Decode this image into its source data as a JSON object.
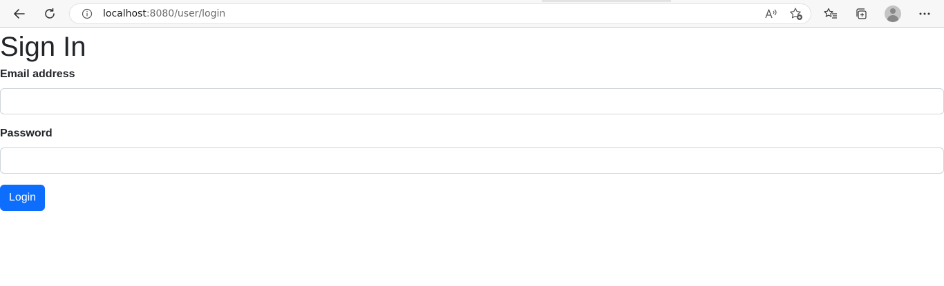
{
  "browser": {
    "url_host": "localhost",
    "url_rest": ":8080/user/login",
    "icons": {
      "back": "arrow-left-icon",
      "refresh": "refresh-icon",
      "info": "info-icon",
      "read_aloud": "read-aloud-icon",
      "add_favorite": "add-favorite-icon",
      "favorites": "favorites-icon",
      "collections": "collections-icon",
      "profile": "profile-avatar-icon",
      "more": "more-icon"
    }
  },
  "page": {
    "title": "Sign In",
    "email_label": "Email address",
    "email_value": "",
    "password_label": "Password",
    "password_value": "",
    "login_button": "Login"
  },
  "colors": {
    "primary": "#0d6efd",
    "text": "#212529",
    "input_border": "#ced4da"
  }
}
